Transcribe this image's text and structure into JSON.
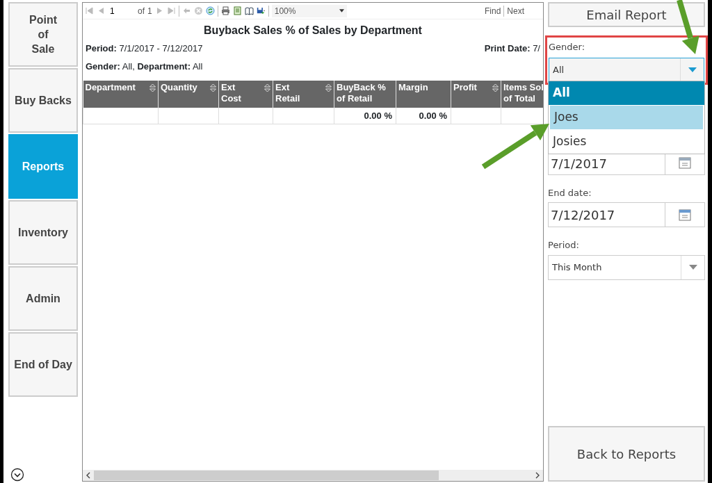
{
  "sidebar": {
    "items": [
      {
        "label": "Point\nof\nSale",
        "selected": false
      },
      {
        "label": "Buy Backs",
        "selected": false
      },
      {
        "label": "Reports",
        "selected": true
      },
      {
        "label": "Inventory",
        "selected": false
      },
      {
        "label": "Admin",
        "selected": false
      },
      {
        "label": "End of Day",
        "selected": false
      }
    ]
  },
  "toolbar": {
    "page": "1",
    "of_label": "of",
    "page_count": "1",
    "zoom": "100%",
    "find": "Find",
    "next": "Next"
  },
  "report": {
    "title": "Buyback Sales % of Sales by Department",
    "period": "**Period:** 7/1/2017 - 7/12/2017",
    "print_date": "**Print Date:** 7/",
    "filters": "**Gender:** All, **Department:** All",
    "columns": [
      {
        "label": "Department",
        "sortable": true
      },
      {
        "label": "Quantity",
        "sortable": true
      },
      {
        "label": "Ext\nCost",
        "sortable": true
      },
      {
        "label": "Ext\nRetail",
        "sortable": true
      },
      {
        "label": "BuyBack %\nof Retail",
        "sortable": false
      },
      {
        "label": "Margin",
        "sortable": false
      },
      {
        "label": "Profit",
        "sortable": true
      },
      {
        "label": "Items Sol\nof Total",
        "sortable": false
      }
    ],
    "rows": [
      [
        "",
        "",
        "",
        "",
        "0.00 %",
        "0.00 %",
        "",
        ""
      ]
    ]
  },
  "panel": {
    "email_button": "Email Report",
    "gender": {
      "label": "Gender:",
      "value": "All",
      "highlighted": true,
      "options": [
        {
          "label": "All",
          "selected": true,
          "hovered": false
        },
        {
          "label": "Joes",
          "selected": false,
          "hovered": true
        },
        {
          "label": "Josies",
          "selected": false,
          "hovered": false
        }
      ]
    },
    "start_date": {
      "value": "7/1/2017"
    },
    "end_date": {
      "label": "End date:",
      "value": "7/12/2017"
    },
    "period": {
      "label": "Period:",
      "value": "This Month"
    },
    "back_button": "Back to Reports"
  },
  "annotations": [
    {
      "kind": "arrow"
    },
    {
      "kind": "arrow"
    }
  ]
}
